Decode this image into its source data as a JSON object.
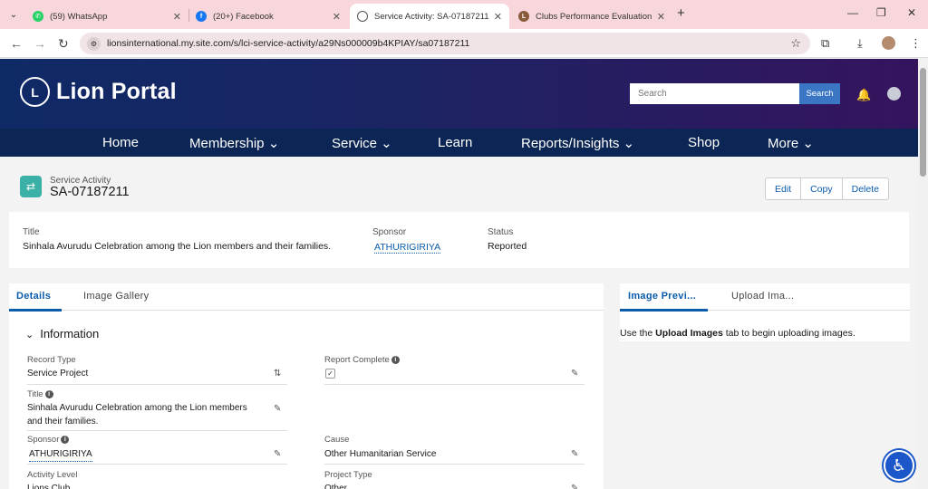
{
  "browser": {
    "tabs": [
      {
        "title": "(59) WhatsApp",
        "icon": "whatsapp-icon",
        "color": "#25d366"
      },
      {
        "title": "(20+) Facebook",
        "icon": "facebook-icon",
        "color": "#1877f2"
      },
      {
        "title": "Service Activity: SA-07187211",
        "icon": "globe-icon",
        "color": "#555555"
      },
      {
        "title": "Clubs Performance Evaluation S",
        "icon": "lions-icon",
        "color": "#8a5b3a"
      }
    ],
    "url": "lionsinternational.my.site.com/s/lci-service-activity/a29Ns000009b4KPIAY/sa07187211"
  },
  "portal": {
    "logo_text": "Lion Portal",
    "search_placeholder": "Search",
    "search_button": "Search",
    "nav": [
      "Home",
      "Membership ⌄",
      "Service ⌄",
      "Learn",
      "Reports/Insights ⌄",
      "Shop",
      "More ⌄"
    ]
  },
  "record": {
    "object_label": "Service Activity",
    "name": "SA-07187211",
    "actions": [
      "Edit",
      "Copy",
      "Delete"
    ]
  },
  "highlights": {
    "title_label": "Title",
    "title_value": "Sinhala Avurudu Celebration among the Lion members and their families.",
    "sponsor_label": "Sponsor",
    "sponsor_value": "ATHURIGIRIYA",
    "status_label": "Status",
    "status_value": "Reported"
  },
  "details": {
    "tabs": [
      "Details",
      "Image Gallery"
    ],
    "section_title": "Information",
    "fields": {
      "record_type_label": "Record Type",
      "record_type_value": "Service Project",
      "report_complete_label": "Report Complete",
      "title_label": "Title",
      "title_value_line1": "Sinhala Avurudu Celebration among the Lion members",
      "title_value_line2": "and their families.",
      "sponsor_label": "Sponsor",
      "sponsor_value": "ATHURIGIRIYA",
      "cause_label": "Cause",
      "cause_value": "Other Humanitarian Service",
      "activity_level_label": "Activity Level",
      "activity_level_value": "Lions Club",
      "project_type_label": "Project Type",
      "project_type_value": "Other"
    }
  },
  "side_panel": {
    "tabs": [
      "Image Previ...",
      "Upload Ima..."
    ],
    "message_prefix": "Use the ",
    "message_bold": "Upload Images",
    "message_suffix": " tab to begin uploading images."
  }
}
